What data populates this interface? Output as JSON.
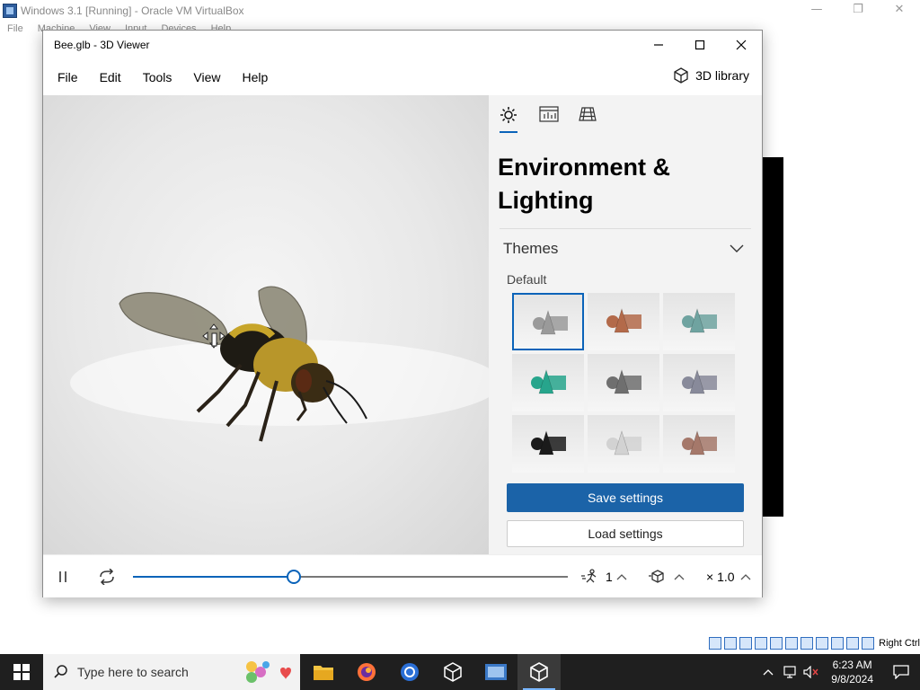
{
  "host": {
    "title": "Windows 3.1 [Running] - Oracle VM VirtualBox",
    "menu": [
      "File",
      "Machine",
      "View",
      "Input",
      "Devices",
      "Help"
    ],
    "status_host_key": "Right Ctrl"
  },
  "viewer": {
    "title": "Bee.glb - 3D Viewer",
    "menu": [
      "File",
      "Edit",
      "Tools",
      "View",
      "Help"
    ],
    "library_label": "3D library",
    "panel": {
      "tabs": [
        "environment-lighting-tab",
        "stats-tab",
        "grid-tab"
      ],
      "heading": "Environment & Lighting",
      "themes_label": "Themes",
      "default_label": "Default",
      "theme_colors": [
        "#9a9a9a",
        "#b36a4a",
        "#6fa3a0",
        "#27a58c",
        "#6f6f6f",
        "#888a9a",
        "#1b1b1b",
        "#d2d2d2",
        "#a5786a"
      ],
      "save_label": "Save settings",
      "load_label": "Load settings"
    },
    "playback": {
      "progress": 0.37,
      "animation_count": "1",
      "speed": "× 1.0"
    }
  },
  "taskbar": {
    "search_placeholder": "Type here to search",
    "time": "6:23 AM",
    "date": "9/8/2024"
  },
  "colors": {
    "accent": "#0a63b9",
    "save_button": "#1b63a8",
    "taskbar": "#1f1f1f"
  }
}
